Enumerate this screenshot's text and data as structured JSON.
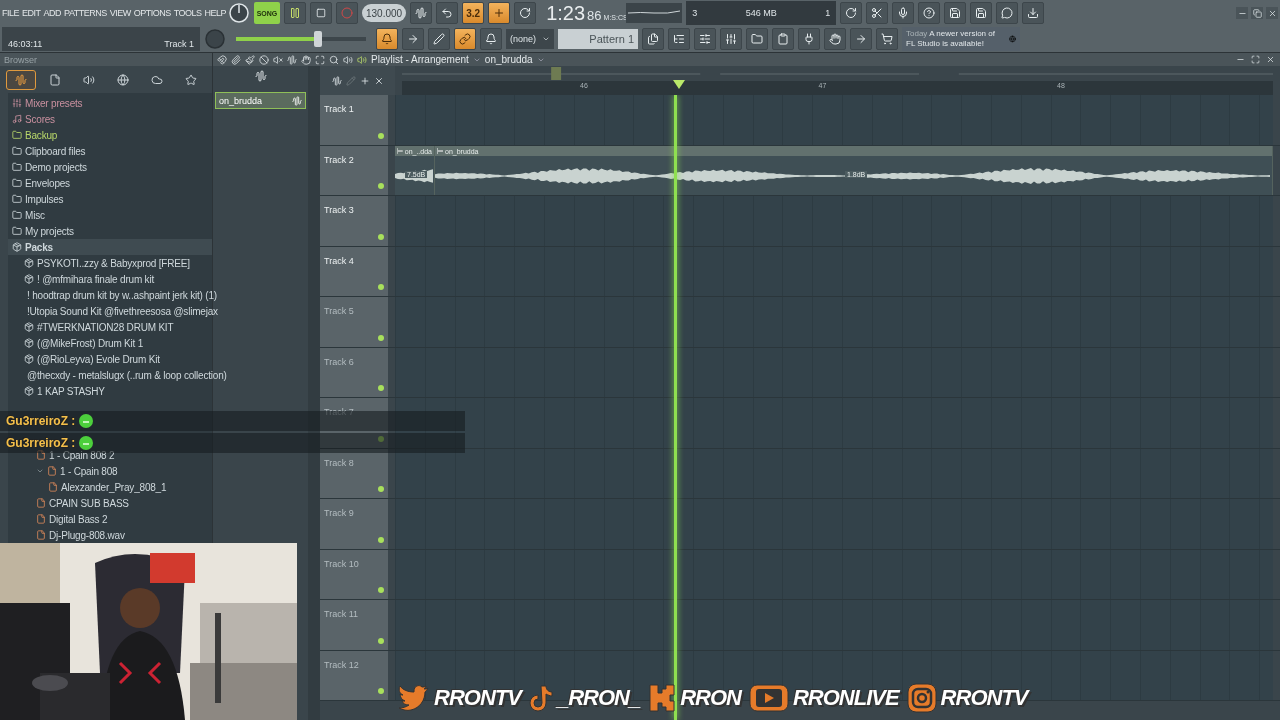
{
  "menu": [
    "FILE",
    "EDIT",
    "ADD",
    "PATTERNS",
    "VIEW",
    "OPTIONS",
    "TOOLS",
    "HELP"
  ],
  "hint": {
    "time": "46:03:11",
    "target": "Track 1"
  },
  "transport": {
    "mode": "SONG",
    "playing": true,
    "recording": false,
    "tempo": "130.000",
    "pitch": {
      "level": 0.6
    }
  },
  "toggles_top": [
    {
      "on": false
    },
    {
      "on": false
    },
    {
      "label": "3.2",
      "on": true
    },
    {
      "on": true
    },
    {
      "on": false
    }
  ],
  "toggles_bottom": [
    {
      "on": true
    },
    {
      "on": false
    },
    {
      "on": false
    },
    {
      "on": true
    },
    {
      "on": false
    }
  ],
  "clock": {
    "time": "1:23",
    "centis": "86",
    "unit": "M:S:CS"
  },
  "monitor": {
    "cpu": "3",
    "memory": "546 MB",
    "polyphony": "1"
  },
  "patterns": {
    "channel": "(none)",
    "pattern": "Pattern 1"
  },
  "news": {
    "when": "Today",
    "text": "A newer version of FL Studio is available!"
  },
  "browser": {
    "title": "Browser",
    "tabs": [
      {
        "selected": true
      },
      {
        "selected": false
      },
      {
        "selected": false
      },
      {
        "selected": false
      },
      {
        "selected": false
      },
      {
        "selected": false
      }
    ],
    "items": [
      {
        "kind": "preset",
        "label": "Mixer presets"
      },
      {
        "kind": "score",
        "label": "Scores"
      },
      {
        "kind": "backup",
        "label": "Backup"
      },
      {
        "kind": "folder",
        "label": "Clipboard files"
      },
      {
        "kind": "folder",
        "label": "Demo projects"
      },
      {
        "kind": "folder",
        "label": "Envelopes"
      },
      {
        "kind": "folder",
        "label": "Impulses"
      },
      {
        "kind": "folder",
        "label": "Misc"
      },
      {
        "kind": "folder",
        "label": "My projects"
      },
      {
        "kind": "pack",
        "label": "Packs",
        "expanded": true,
        "children": [
          {
            "kind": "pack",
            "label": "PSYKOTI..zzy & Babyxprod [FREE]"
          },
          {
            "kind": "pack",
            "label": "!   @mfmihara finale drum kit"
          },
          {
            "kind": "pack",
            "label": "! hoodtrap drum kit by w..ashpaint jerk kit) (1)"
          },
          {
            "kind": "pack",
            "label": "!Utopia Sound Kit @fivethreesosa @slimejax"
          },
          {
            "kind": "pack",
            "label": "#TWERKNATION28 DRUM KIT"
          },
          {
            "kind": "pack",
            "label": "(@MikeFrost) Drum Kit 1"
          },
          {
            "kind": "pack",
            "label": "(@RioLeyva) Evole Drum Kit"
          },
          {
            "kind": "pack",
            "label": "@thecxdy - metalslugx (..rum & loop collection)"
          },
          {
            "kind": "pack",
            "label": "1 KAP STASHY"
          },
          {
            "kind": "pack"
          },
          {
            "kind": "pack"
          },
          {
            "kind": "pack",
            "expanded": true,
            "children": [
              {
                "kind": "audio",
                "label": "1 - Cpain 808 2"
              },
              {
                "kind": "audio",
                "label": "1 - Cpain 808",
                "expanded": true,
                "children": [
                  {
                    "kind": "audio",
                    "label": "Alexzander_Pray_808_1"
                  }
                ]
              },
              {
                "kind": "audio",
                "label": "CPAIN SUB BASS"
              },
              {
                "kind": "audio",
                "label": "Digital Bass 2"
              },
              {
                "kind": "audio",
                "label": "Dj-Plugg-808.wav"
              }
            ]
          }
        ]
      }
    ]
  },
  "playlist": {
    "title": "Playlist - Arrangement",
    "arrangement": "on_brudda",
    "picker": [
      {
        "label": "on_brudda",
        "selected": true
      }
    ],
    "ruler": [
      "46",
      "47",
      "48"
    ],
    "playhead": {
      "level": 0.318
    },
    "tracks": [
      {
        "label": "Track 1",
        "active": true
      },
      {
        "label": "Track 2",
        "active": true,
        "clips": [
          {
            "label": "on_..dda",
            "gain": "7.5dB"
          },
          {
            "label": "on_brudda",
            "gain": "1.8dB"
          }
        ]
      },
      {
        "label": "Track 3",
        "active": true
      },
      {
        "label": "Track 4",
        "active": true
      },
      {
        "label": "Track 5",
        "active": false
      },
      {
        "label": "Track 6",
        "active": false
      },
      {
        "label": "Track 7",
        "active": false
      },
      {
        "label": "Track 8",
        "active": false
      },
      {
        "label": "Track 9",
        "active": false
      },
      {
        "label": "Track 10",
        "active": false
      },
      {
        "label": "Track 11",
        "active": false
      },
      {
        "label": "Track 12",
        "active": false
      }
    ]
  },
  "chat": [
    {
      "user": "Gu3rreiroZ :"
    },
    {
      "user": "Gu3rreiroZ :"
    }
  ],
  "socials": [
    {
      "kind": "twitter",
      "handle": "RRONTV"
    },
    {
      "kind": "tiktok",
      "handle": "_RRON_"
    },
    {
      "kind": "kick",
      "handle": "RRON"
    },
    {
      "kind": "youtube",
      "handle": "RRONLIVE"
    },
    {
      "kind": "instagram",
      "handle": "RRONTV"
    }
  ]
}
